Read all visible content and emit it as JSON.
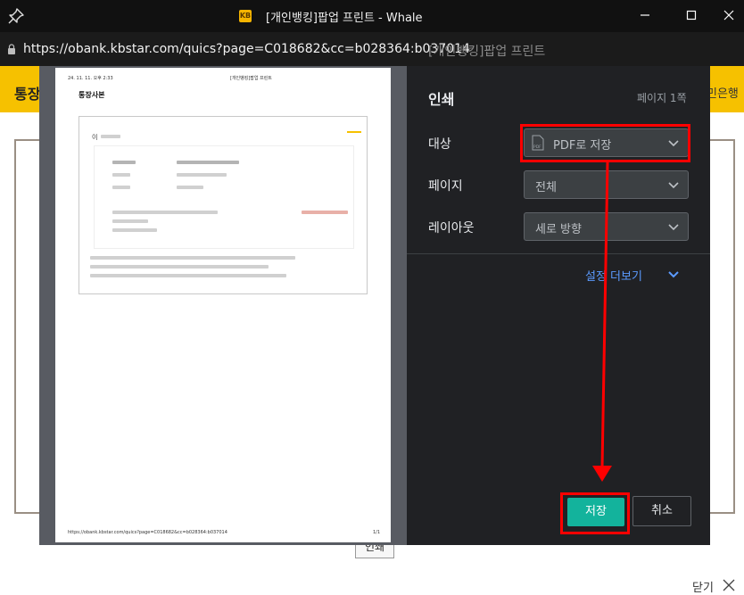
{
  "window": {
    "title": "[개인뱅킹]팝업 프린트 - Whale",
    "favicon_text": "KB"
  },
  "address_bar": {
    "url": "https://obank.kbstar.com/quics?page=C018682&cc=b028364:b037014",
    "page_title": "[개인뱅킹]팝업 프린트"
  },
  "background_page": {
    "title": "통장",
    "brand": "민은행",
    "print_button": "인쇄",
    "close_label": "닫기"
  },
  "preview": {
    "header_left": "24. 11. 11. 오후 2:33",
    "header_center": "[개인뱅킹]팝업 프린트",
    "doc_title": "통장사본",
    "field_label": "이",
    "footer_left": "https://obank.kbstar.com/quics?page=C018682&cc=b028364:b037014",
    "footer_right": "1/1"
  },
  "print_settings": {
    "title": "인쇄",
    "page_count": "페이지 1쪽",
    "destination": {
      "label": "대상",
      "value": "PDF로 저장"
    },
    "pages": {
      "label": "페이지",
      "value": "전체"
    },
    "layout": {
      "label": "레이아웃",
      "value": "세로 방향"
    },
    "more_settings": "설정 더보기",
    "save_button": "저장",
    "cancel_button": "취소"
  },
  "colors": {
    "annotation": "#ff0000",
    "save_button": "#13b39c",
    "kb_yellow": "#f6c100",
    "link_blue": "#5b9bff"
  },
  "icons": [
    "pin-icon",
    "minimize-icon",
    "maximize-icon",
    "close-icon",
    "lock-icon",
    "pdf-file-icon",
    "chevron-down-icon"
  ]
}
